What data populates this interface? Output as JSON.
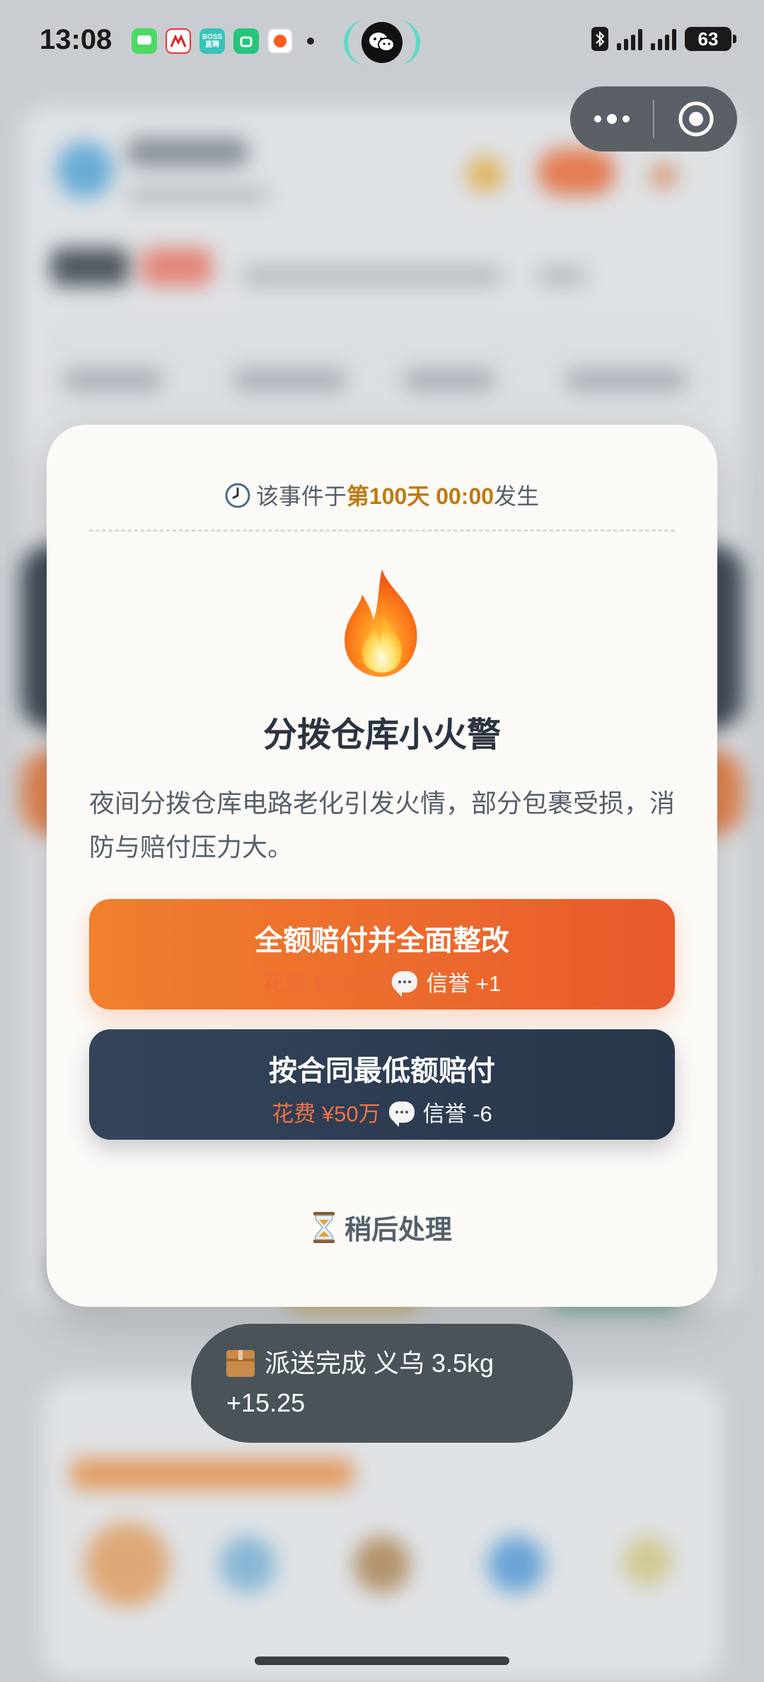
{
  "status_bar": {
    "time": "13:08",
    "battery": "63",
    "app_icons": [
      "messages-icon",
      "bank-icon",
      "boss-zhipin-icon",
      "xiaomi-home-icon",
      "taobao-icon"
    ],
    "boss_label": "BOSS 直聘"
  },
  "capsule": {
    "more_icon": "more-dots-icon",
    "close_icon": "target-close-icon"
  },
  "event": {
    "time_prefix": "该事件于",
    "time_highlight": "第100天 00:00",
    "time_suffix": "发生",
    "icon": "fire-icon",
    "title": "分拨仓库小火警",
    "description": "夜间分拨仓库电路老化引发火情，部分包裹受损，消防与赔付压力大。"
  },
  "options": [
    {
      "label": "全额赔付并全面整改",
      "cost": "花费 ¥200万",
      "effect": "信誉 +1",
      "accent": "#f0802e"
    },
    {
      "label": "按合同最低额赔付",
      "cost": "花费 ¥50万",
      "effect": "信誉 -6",
      "accent": "#2d3d52"
    }
  ],
  "later": {
    "label": "稍后处理",
    "icon": "hourglass-icon"
  },
  "toast": {
    "line1": "派送完成 义乌 3.5kg",
    "line2": "+15.25",
    "icon": "package-icon"
  }
}
